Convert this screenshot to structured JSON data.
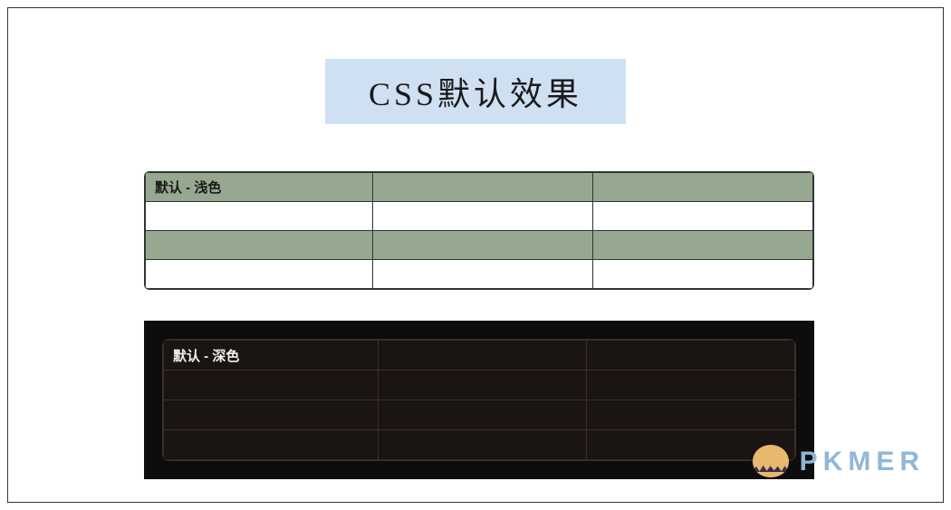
{
  "title": "CSS默认效果",
  "light_table": {
    "header": "默认 - 浅色"
  },
  "dark_table": {
    "header": "默认 - 深色"
  },
  "watermark": {
    "text": "PKMER"
  }
}
